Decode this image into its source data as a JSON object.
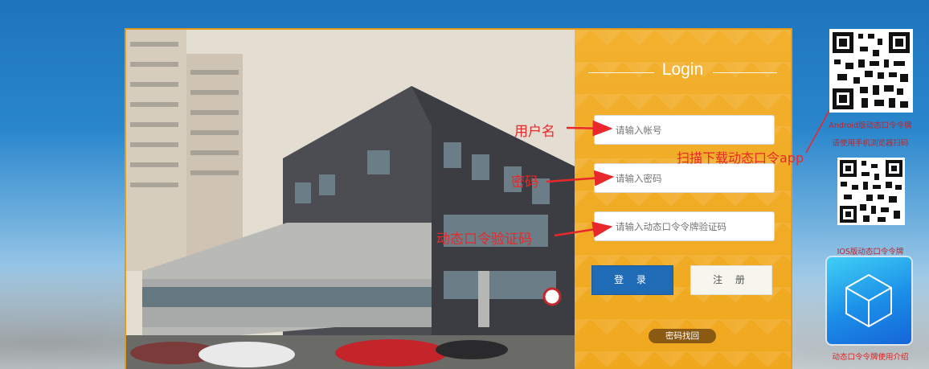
{
  "login": {
    "title": "Login",
    "username_placeholder": "请输入帐号",
    "password_placeholder": "请输入密码",
    "token_placeholder": "请输入动态口令令牌验证码",
    "login_button": "登 录",
    "register_button": "注 册",
    "recover_button": "密码找回"
  },
  "annotations": {
    "username": "用户名",
    "password": "密码",
    "token": "动态口令验证码",
    "scan": "扫描下载动态口令app"
  },
  "sidebar": {
    "android_caption": "Android版动态口令令牌",
    "android_hint": "请使用手机浏览器扫码",
    "ios_caption": "IOS版动态口令令牌",
    "guide_caption": "动态口令令牌使用介绍"
  },
  "colors": {
    "accent_orange": "#f2b02d",
    "login_blue": "#1f6bb5",
    "annotation_red": "#e8282a"
  }
}
